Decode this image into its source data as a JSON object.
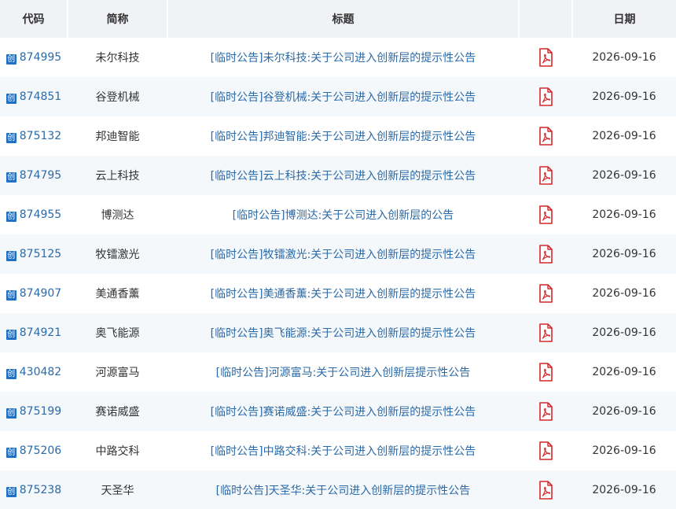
{
  "header": {
    "code": "代码",
    "name": "简称",
    "title": "标题",
    "file": "",
    "date": "日期"
  },
  "badge_label": "创",
  "colors": {
    "link": "#2a6aa8",
    "badge": "#1f6fc4",
    "pdf": "#d2282d",
    "header_bg": "#f1f2f5",
    "row_alt_bg": "#f5f8fb"
  },
  "rows": [
    {
      "code": "874995",
      "name": "未尔科技",
      "title": "[临时公告]未尔科技:关于公司进入创新层的提示性公告",
      "date": "2026-09-16",
      "icon": "pdf-icon"
    },
    {
      "code": "874851",
      "name": "谷登机械",
      "title": "[临时公告]谷登机械:关于公司进入创新层的提示性公告",
      "date": "2026-09-16",
      "icon": "pdf-icon"
    },
    {
      "code": "875132",
      "name": "邦迪智能",
      "title": "[临时公告]邦迪智能:关于公司进入创新层的提示性公告",
      "date": "2026-09-16",
      "icon": "pdf-icon"
    },
    {
      "code": "874795",
      "name": "云上科技",
      "title": "[临时公告]云上科技:关于公司进入创新层的提示性公告",
      "date": "2026-09-16",
      "icon": "pdf-icon"
    },
    {
      "code": "874955",
      "name": "博测达",
      "title": "[临时公告]博测达:关于公司进入创新层的公告",
      "date": "2026-09-16",
      "icon": "pdf-icon"
    },
    {
      "code": "875125",
      "name": "牧镭激光",
      "title": "[临时公告]牧镭激光:关于公司进入创新层的提示性公告",
      "date": "2026-09-16",
      "icon": "pdf-icon"
    },
    {
      "code": "874907",
      "name": "美通香薰",
      "title": "[临时公告]美通香薰:关于公司进入创新层的提示性公告",
      "date": "2026-09-16",
      "icon": "pdf-icon"
    },
    {
      "code": "874921",
      "name": "奥飞能源",
      "title": "[临时公告]奥飞能源:关于公司进入创新层的提示性公告",
      "date": "2026-09-16",
      "icon": "pdf-icon"
    },
    {
      "code": "430482",
      "name": "河源富马",
      "title": "[临时公告]河源富马:关于公司进入创新层提示性公告",
      "date": "2026-09-16",
      "icon": "pdf-icon"
    },
    {
      "code": "875199",
      "name": "赛诺威盛",
      "title": "[临时公告]赛诺威盛:关于公司进入创新层的提示性公告",
      "date": "2026-09-16",
      "icon": "pdf-icon"
    },
    {
      "code": "875206",
      "name": "中路交科",
      "title": "[临时公告]中路交科:关于公司进入创新层的提示性公告",
      "date": "2026-09-16",
      "icon": "pdf-icon"
    },
    {
      "code": "875238",
      "name": "天圣华",
      "title": "[临时公告]天圣华:关于公司进入创新层的提示性公告",
      "date": "2026-09-16",
      "icon": "pdf-icon"
    }
  ]
}
